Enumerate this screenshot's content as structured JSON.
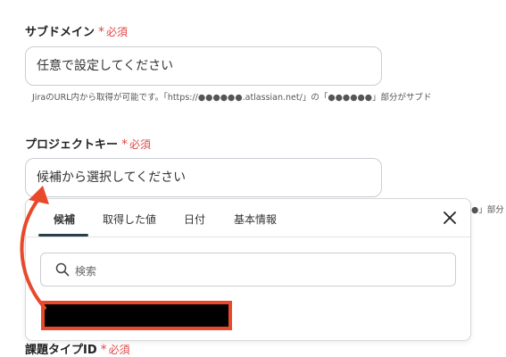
{
  "subdomain": {
    "label": "サブドメイン",
    "required": "必須",
    "required_mark": "*",
    "placeholder": "任意で設定してください",
    "hint": "JiraのURL内から取得が可能です。「https://●●●●●●.atlassian.net/」の「●●●●●●」部分がサブド"
  },
  "project_key": {
    "label": "プロジェクトキー",
    "required": "必須",
    "required_mark": "*",
    "placeholder": "候補から選択してください",
    "hint_fragment": "●」部分"
  },
  "issue_type": {
    "label": "課題タイプID",
    "required": "必須",
    "required_mark": "*"
  },
  "popup": {
    "tabs": [
      "候補",
      "取得した値",
      "日付",
      "基本情報"
    ],
    "active_tab": "候補",
    "search_placeholder": "検索"
  },
  "colors": {
    "required": "#e04848",
    "annotation": "#e8492a",
    "tab_underline": "#2a3e4a"
  }
}
